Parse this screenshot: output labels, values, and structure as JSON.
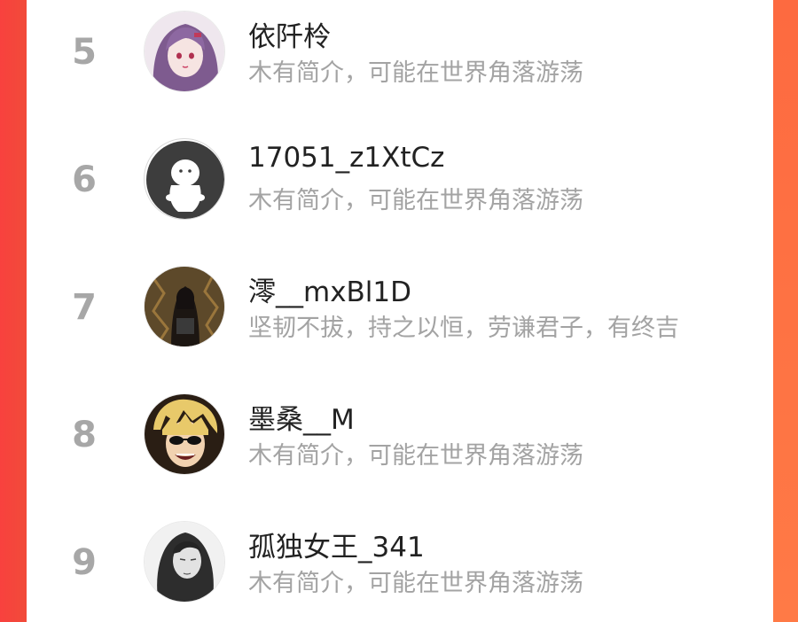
{
  "ranking": {
    "rows": [
      {
        "rank": "5",
        "name": "依阡柃",
        "bio": "木有简介，可能在世界角落游荡",
        "avatar": "anime-girl-purple-hair-avatar"
      },
      {
        "rank": "6",
        "name": "17051_z1XtCz",
        "bio": "木有简介，可能在世界角落游荡",
        "avatar": "default-user-avatar"
      },
      {
        "rank": "7",
        "name": "澪__mxBl1D",
        "bio": "坚韧不拔，持之以恒，劳谦君子，有终吉",
        "avatar": "dark-anime-figure-avatar"
      },
      {
        "rank": "8",
        "name": "墨桑__M",
        "bio": "木有简介，可能在世界角落游荡",
        "avatar": "sunglasses-anime-boy-avatar"
      },
      {
        "rank": "9",
        "name": "孤独女王_341",
        "bio": "木有简介，可能在世界角落游荡",
        "avatar": "long-hair-girl-sketch-avatar"
      }
    ]
  },
  "colors": {
    "accent_left": "#f8413e",
    "accent_right": "#fd7a45",
    "rank_gray": "#a7a7a7",
    "name_dark": "#222222",
    "bio_gray": "#a3a3a3"
  }
}
